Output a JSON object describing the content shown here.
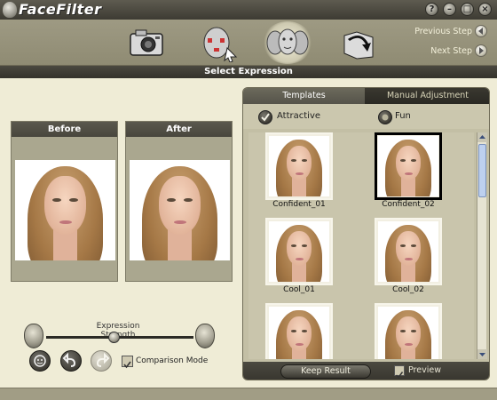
{
  "app": {
    "title": "FaceFilter"
  },
  "window_controls": {
    "help": "?",
    "minimize": "–",
    "maximize": "□",
    "close": "×"
  },
  "toolbar": {
    "previous_step": "Previous Step",
    "next_step": "Next Step",
    "steps": [
      "camera-icon",
      "robot-icon",
      "faces-icon",
      "back-folder-icon"
    ]
  },
  "section": {
    "title": "Select Expression"
  },
  "preview": {
    "before_label": "Before",
    "after_label": "After"
  },
  "expression": {
    "strength_label": "Expression Strength",
    "strength_value": 0.46,
    "comparison_mode_label": "Comparison Mode",
    "comparison_mode_checked": true
  },
  "right_panel": {
    "tabs": [
      {
        "label": "Templates",
        "active": true
      },
      {
        "label": "Manual Adjustment",
        "active": false
      }
    ],
    "options": [
      {
        "label": "Attractive",
        "selected": true
      },
      {
        "label": "Fun",
        "selected": false
      }
    ],
    "templates": [
      {
        "label": "Confident_01",
        "selected": false
      },
      {
        "label": "Confident_02",
        "selected": true
      },
      {
        "label": "Cool_01",
        "selected": false
      },
      {
        "label": "Cool_02",
        "selected": false
      },
      {
        "label": "",
        "selected": false
      },
      {
        "label": "",
        "selected": false
      }
    ],
    "keep_result_label": "Keep Result",
    "preview_label": "Preview",
    "preview_checked": true
  },
  "colors": {
    "background": "#efecd6",
    "toolbar": "#9e9a83",
    "header": "#3d3b33",
    "selected_border": "#000000"
  }
}
